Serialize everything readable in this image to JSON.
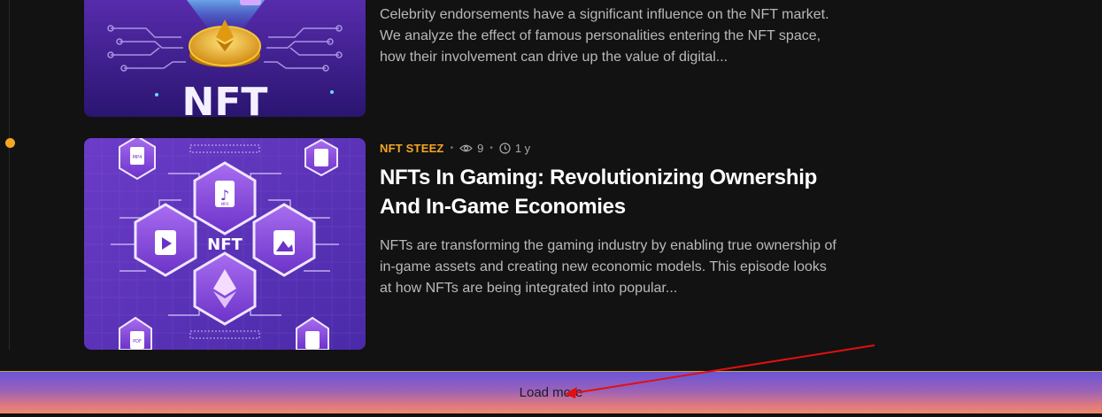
{
  "posts": [
    {
      "excerpt": "Celebrity endorsements have a significant influence on the NFT market. We analyze the effect of famous personalities entering the NFT space, how their involvement can drive up the value of digital...",
      "thumb_text": "NFT"
    },
    {
      "category": "NFT STEEZ",
      "views": "9",
      "age": "1 y",
      "title": "NFTs In Gaming: Revolutionizing Ownership And In-Game Economies",
      "excerpt": "NFTs are transforming the gaming industry by enabling true ownership of in-game assets and creating new economic models. This episode looks at how NFTs are being integrated into popular...",
      "thumb_text": "NFT",
      "thumb_labels": [
        "MP4",
        "MP3",
        "PDF"
      ]
    }
  ],
  "load_more": {
    "label": "Load more"
  },
  "colors": {
    "accent": "#f5a623",
    "background": "#121212",
    "annotation": "#e01010"
  }
}
